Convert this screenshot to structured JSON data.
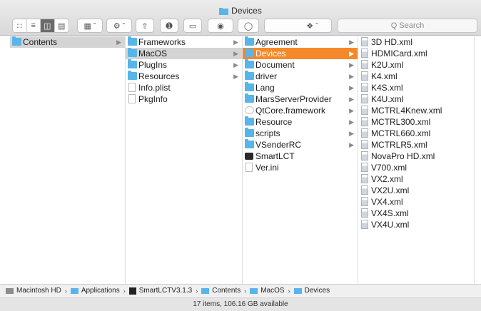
{
  "window": {
    "title": "Devices"
  },
  "toolbar": {
    "search_placeholder": "Q Search"
  },
  "columns": [
    {
      "items": [
        {
          "label": "Contents",
          "type": "folder",
          "chevron": true,
          "state": "selected-gray"
        }
      ]
    },
    {
      "items": [
        {
          "label": "Frameworks",
          "type": "folder",
          "chevron": true
        },
        {
          "label": "MacOS",
          "type": "folder",
          "chevron": true,
          "state": "selected-gray"
        },
        {
          "label": "PlugIns",
          "type": "folder",
          "chevron": true
        },
        {
          "label": "Resources",
          "type": "folder",
          "chevron": true
        },
        {
          "label": "Info.plist",
          "type": "file"
        },
        {
          "label": "PkgInfo",
          "type": "file"
        }
      ]
    },
    {
      "items": [
        {
          "label": "Agreement",
          "type": "folder",
          "chevron": true
        },
        {
          "label": "Devices",
          "type": "folder",
          "chevron": true,
          "state": "selected-active"
        },
        {
          "label": "Document",
          "type": "folder",
          "chevron": true
        },
        {
          "label": "driver",
          "type": "folder",
          "chevron": true
        },
        {
          "label": "Lang",
          "type": "folder",
          "chevron": true
        },
        {
          "label": "MarsServerProvider",
          "type": "folder",
          "chevron": true
        },
        {
          "label": "QtCore.framework",
          "type": "framework",
          "chevron": true
        },
        {
          "label": "Resource",
          "type": "folder",
          "chevron": true
        },
        {
          "label": "scripts",
          "type": "folder",
          "chevron": true
        },
        {
          "label": "VSenderRC",
          "type": "folder",
          "chevron": true
        },
        {
          "label": "SmartLCT",
          "type": "app"
        },
        {
          "label": "Ver.ini",
          "type": "file"
        }
      ]
    },
    {
      "items": [
        {
          "label": "3D HD.xml",
          "type": "xml"
        },
        {
          "label": "HDMICard.xml",
          "type": "xml"
        },
        {
          "label": "K2U.xml",
          "type": "xml"
        },
        {
          "label": "K4.xml",
          "type": "xml"
        },
        {
          "label": "K4S.xml",
          "type": "xml"
        },
        {
          "label": "K4U.xml",
          "type": "xml"
        },
        {
          "label": "MCTRL4Knew.xml",
          "type": "xml"
        },
        {
          "label": "MCTRL300.xml",
          "type": "xml"
        },
        {
          "label": "MCTRL660.xml",
          "type": "xml"
        },
        {
          "label": "MCTRLR5.xml",
          "type": "xml"
        },
        {
          "label": "NovaPro HD.xml",
          "type": "xml"
        },
        {
          "label": "V700.xml",
          "type": "xml"
        },
        {
          "label": "VX2.xml",
          "type": "xml"
        },
        {
          "label": "VX2U.xml",
          "type": "xml"
        },
        {
          "label": "VX4.xml",
          "type": "xml"
        },
        {
          "label": "VX4S.xml",
          "type": "xml"
        },
        {
          "label": "VX4U.xml",
          "type": "xml"
        }
      ]
    }
  ],
  "pathbar": [
    {
      "label": "Macintosh HD",
      "icon": "hd"
    },
    {
      "label": "Applications",
      "icon": "folder"
    },
    {
      "label": "SmartLCTV3.1.3",
      "icon": "app"
    },
    {
      "label": "Contents",
      "icon": "folder"
    },
    {
      "label": "MacOS",
      "icon": "folder"
    },
    {
      "label": "Devices",
      "icon": "folder"
    }
  ],
  "status": {
    "text": "17 items, 106.16 GB available"
  },
  "colors": {
    "selection_active": "#f5892a",
    "folder": "#58b5ea"
  }
}
